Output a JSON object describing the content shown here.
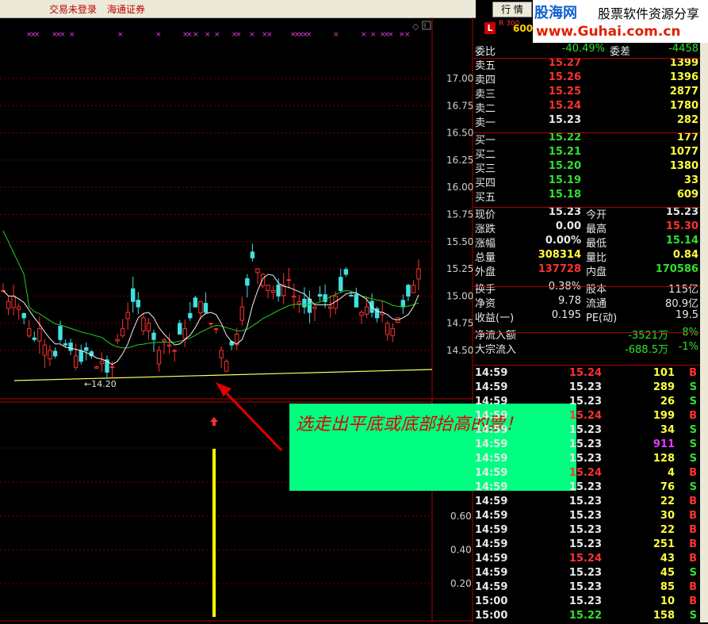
{
  "topbar": {
    "not_logged_in": "交易未登录",
    "broker": "海通证券",
    "hq_button": "行 情"
  },
  "logo": {
    "name": "股海网",
    "desc": "股票软件资源分享",
    "url": "www.Guhai.com.cn"
  },
  "stock": {
    "badge": "L",
    "index_tag": "R 300",
    "code": "600"
  },
  "chart": {
    "price_axis": [
      "17.00",
      "16.75",
      "16.50",
      "16.25",
      "16.00",
      "15.75",
      "15.50",
      "15.25",
      "15.00",
      "14.75",
      "14.50"
    ],
    "low_label": "←14.20",
    "indicator_axis": [
      "0.60",
      "0.40",
      "0.20"
    ]
  },
  "annotation": {
    "text": "选走出平底或底部抬高的票！"
  },
  "quote": {
    "ratio": {
      "label1": "委比",
      "value1": "-40.49%",
      "label2": "委差",
      "value2": "-4458"
    },
    "asks": [
      {
        "label": "卖五",
        "price": "15.27",
        "vol": "1399"
      },
      {
        "label": "卖四",
        "price": "15.26",
        "vol": "1396"
      },
      {
        "label": "卖三",
        "price": "15.25",
        "vol": "2877"
      },
      {
        "label": "卖二",
        "price": "15.24",
        "vol": "1780"
      },
      {
        "label": "卖一",
        "price": "15.23",
        "vol": "282"
      }
    ],
    "bids": [
      {
        "label": "买一",
        "price": "15.22",
        "vol": "177"
      },
      {
        "label": "买二",
        "price": "15.21",
        "vol": "1077"
      },
      {
        "label": "买三",
        "price": "15.20",
        "vol": "1380"
      },
      {
        "label": "买四",
        "price": "15.19",
        "vol": "33"
      },
      {
        "label": "买五",
        "price": "15.18",
        "vol": "609"
      }
    ],
    "stats1": [
      {
        "l1": "现价",
        "v1": "15.23",
        "l2": "今开",
        "v2": "15.23"
      },
      {
        "l1": "涨跌",
        "v1": "0.00",
        "l2": "最高",
        "v2": "15.30"
      },
      {
        "l1": "涨幅",
        "v1": "0.00%",
        "l2": "最低",
        "v2": "15.14"
      },
      {
        "l1": "总量",
        "v1": "308314",
        "l2": "量比",
        "v2": "0.84"
      },
      {
        "l1": "外盘",
        "v1": "137728",
        "l2": "内盘",
        "v2": "170586"
      }
    ],
    "stats2": [
      {
        "l1": "换手",
        "v1": "0.38%",
        "l2": "股本",
        "v2": "115亿"
      },
      {
        "l1": "净资",
        "v1": "9.78",
        "l2": "流通",
        "v2": "80.9亿"
      },
      {
        "l1": "收益(一)",
        "v1": "0.195",
        "l2": "PE(动)",
        "v2": "19.5"
      }
    ],
    "flows": [
      {
        "label": "净流入额",
        "value": "-3521万",
        "pct": "-8%"
      },
      {
        "label": "大宗流入",
        "value": "-688.5万",
        "pct": "-1%"
      }
    ]
  },
  "trades": [
    {
      "t": "14:59",
      "p": "15.24",
      "v": "101",
      "s": "B"
    },
    {
      "t": "14:59",
      "p": "15.23",
      "v": "289",
      "s": "S"
    },
    {
      "t": "14:59",
      "p": "15.23",
      "v": "26",
      "s": "S"
    },
    {
      "t": "14:59",
      "p": "15.24",
      "v": "199",
      "s": "B"
    },
    {
      "t": "14:59",
      "p": "15.23",
      "v": "34",
      "s": "S"
    },
    {
      "t": "14:59",
      "p": "15.23",
      "v": "911",
      "s": "S"
    },
    {
      "t": "14:59",
      "p": "15.23",
      "v": "128",
      "s": "S"
    },
    {
      "t": "14:59",
      "p": "15.24",
      "v": "4",
      "s": "B"
    },
    {
      "t": "14:59",
      "p": "15.23",
      "v": "76",
      "s": "S"
    },
    {
      "t": "14:59",
      "p": "15.23",
      "v": "22",
      "s": "B"
    },
    {
      "t": "14:59",
      "p": "15.23",
      "v": "30",
      "s": "B"
    },
    {
      "t": "14:59",
      "p": "15.23",
      "v": "22",
      "s": "B"
    },
    {
      "t": "14:59",
      "p": "15.23",
      "v": "251",
      "s": "B"
    },
    {
      "t": "14:59",
      "p": "15.24",
      "v": "43",
      "s": "B"
    },
    {
      "t": "14:59",
      "p": "15.23",
      "v": "45",
      "s": "S"
    },
    {
      "t": "14:59",
      "p": "15.23",
      "v": "85",
      "s": "B"
    },
    {
      "t": "15:00",
      "p": "15.23",
      "v": "10",
      "s": "B"
    },
    {
      "t": "15:00",
      "p": "15.22",
      "v": "158",
      "s": "S"
    }
  ]
}
